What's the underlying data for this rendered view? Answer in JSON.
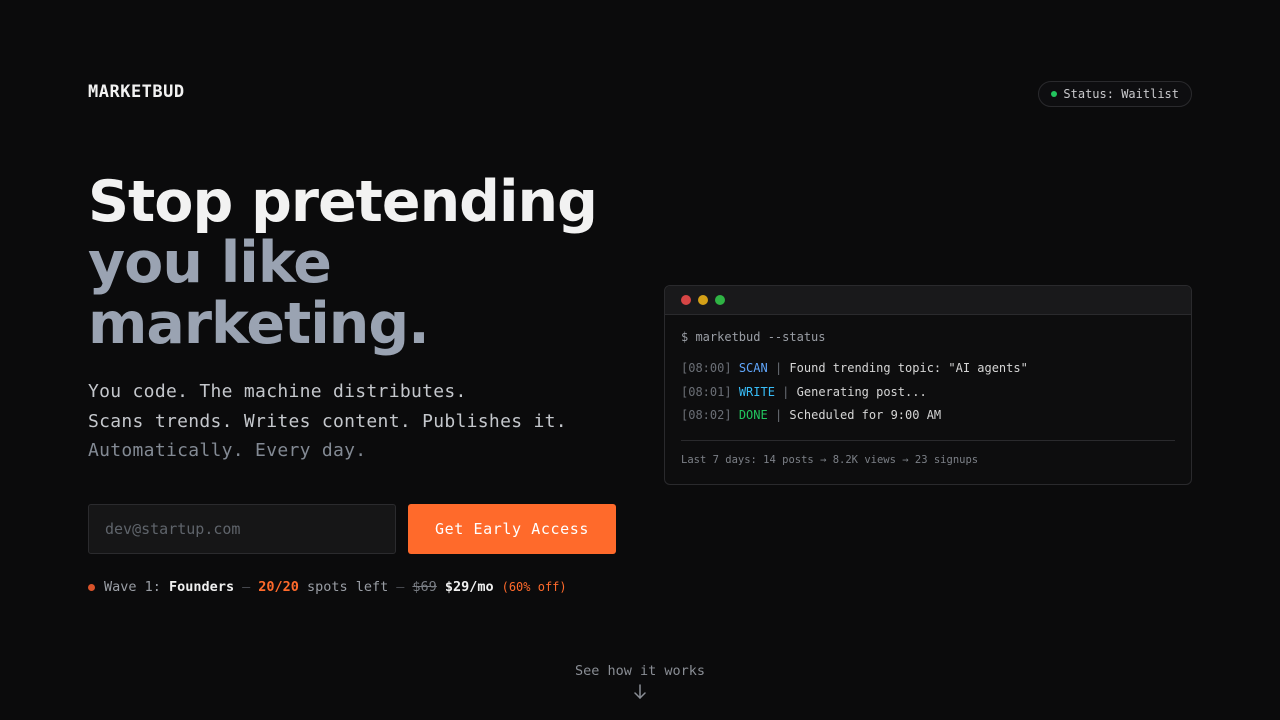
{
  "brand": {
    "name": "MARKETBUD"
  },
  "status": {
    "label": "Status: Waitlist",
    "dot_color": "#22c55e"
  },
  "hero": {
    "title_line1": "Stop pretending",
    "title_line2": "you like",
    "title_line3": "marketing.",
    "sub_line1": "You code. The machine distributes.",
    "sub_line2": "Scans trends. Writes content. Publishes it.",
    "sub_line3": "Automatically. Every day."
  },
  "signup": {
    "email_placeholder": "dev@startup.com",
    "email_value": "",
    "button_label": "Get Early Access",
    "accent_color": "#ff6a2b"
  },
  "offer": {
    "wave_label": "Wave 1:",
    "wave_name": "Founders",
    "dash1": "—",
    "spots": "20/20",
    "spots_suffix": "spots left",
    "dash2": "—",
    "old_price": "$69",
    "price": "$29/mo",
    "discount": "(60% off)"
  },
  "terminal": {
    "dots": [
      {
        "name": "close",
        "color": "#d64545"
      },
      {
        "name": "minimize",
        "color": "#d4a017"
      },
      {
        "name": "maximize",
        "color": "#2fb344"
      }
    ],
    "command": "$ marketbud --status",
    "log": [
      {
        "time": "[08:00]",
        "tag": "SCAN",
        "tag_color": "#60a5fa",
        "message": "Found trending topic: \"AI agents\""
      },
      {
        "time": "[08:01]",
        "tag": "WRITE",
        "tag_color": "#38bdf8",
        "message": "Generating post..."
      },
      {
        "time": "[08:02]",
        "tag": "DONE",
        "tag_color": "#22c55e",
        "message": "Scheduled for 9:00 AM"
      }
    ],
    "footer": "Last 7 days: 14 posts → 8.2K views → 23 signups"
  },
  "scroll_hint": {
    "label": "See how it works",
    "icon": "arrow-down-icon"
  }
}
